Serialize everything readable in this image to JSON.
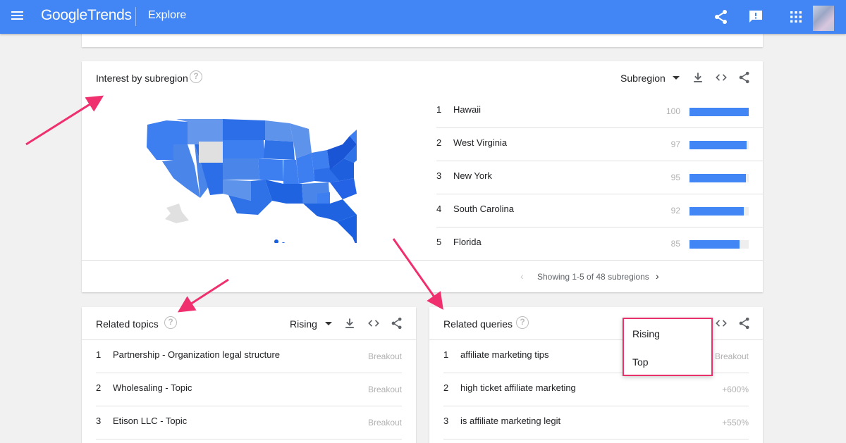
{
  "header": {
    "logo_google": "Google",
    "logo_trends": "Trends",
    "page_title": "Explore"
  },
  "subregion": {
    "title": "Interest by subregion",
    "resolution": "Subregion",
    "regions": [
      {
        "rank": "1",
        "name": "Hawaii",
        "value": "100",
        "pct": 100
      },
      {
        "rank": "2",
        "name": "West Virginia",
        "value": "97",
        "pct": 97
      },
      {
        "rank": "3",
        "name": "New York",
        "value": "95",
        "pct": 95
      },
      {
        "rank": "4",
        "name": "South Carolina",
        "value": "92",
        "pct": 92
      },
      {
        "rank": "5",
        "name": "Florida",
        "value": "85",
        "pct": 85
      }
    ],
    "pager_text": "Showing 1-5 of 48 subregions"
  },
  "topics": {
    "title": "Related topics",
    "filter": "Rising",
    "rows": [
      {
        "rank": "1",
        "text": "Partnership - Organization legal structure",
        "meta": "Breakout"
      },
      {
        "rank": "2",
        "text": "Wholesaling - Topic",
        "meta": "Breakout"
      },
      {
        "rank": "3",
        "text": "Etison LLC - Topic",
        "meta": "Breakout"
      }
    ]
  },
  "queries": {
    "title": "Related queries",
    "rows": [
      {
        "rank": "1",
        "text": "affiliate marketing tips",
        "meta": "Breakout"
      },
      {
        "rank": "2",
        "text": "high ticket affiliate marketing",
        "meta": "+600%"
      },
      {
        "rank": "3",
        "text": "is affiliate marketing legit",
        "meta": "+550%"
      }
    ],
    "dropdown": {
      "options": [
        "Rising",
        "Top"
      ]
    }
  },
  "colors": {
    "brand_blue": "#4285f4",
    "bar_fill": "#4285f4",
    "highlight_pink": "#e8306b"
  }
}
